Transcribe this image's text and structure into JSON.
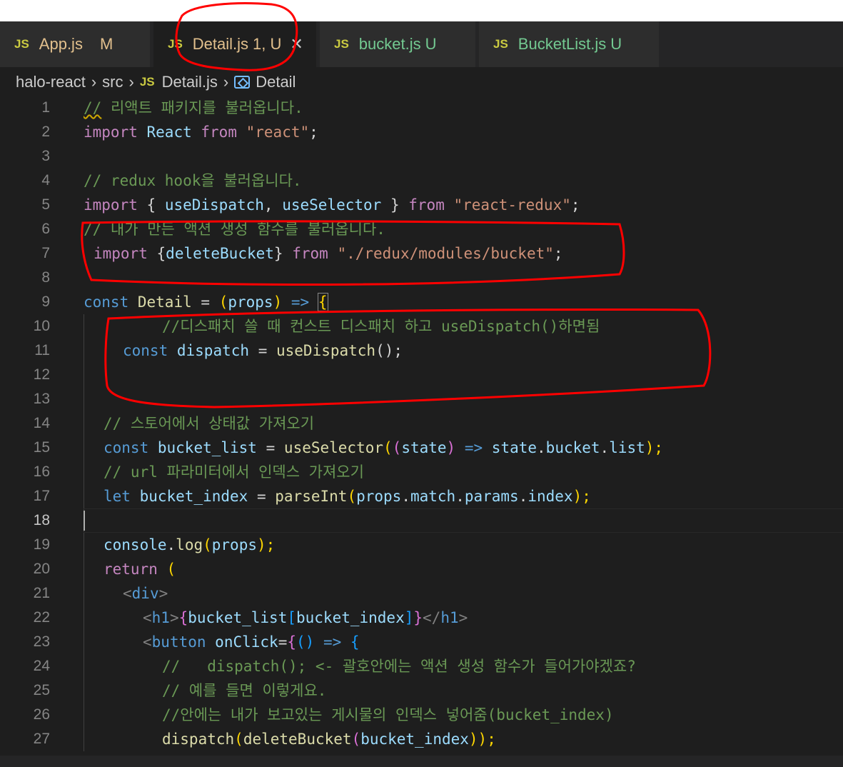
{
  "tabs": [
    {
      "badge": "JS",
      "name": "App.js",
      "status": "M"
    },
    {
      "badge": "JS",
      "name": "Detail.js",
      "status": "1, U",
      "close": "✕"
    },
    {
      "badge": "JS",
      "name": "bucket.js",
      "status": "U"
    },
    {
      "badge": "JS",
      "name": "BucketList.js",
      "status": "U"
    }
  ],
  "breadcrumb": {
    "folder": "halo-react",
    "sep": "›",
    "src": "src",
    "js_badge": "JS",
    "file": "Detail.js",
    "symbol": "Detail"
  },
  "editor": {
    "current_line": 18,
    "line_numbers": [
      "1",
      "2",
      "3",
      "4",
      "5",
      "6",
      "7",
      "8",
      "9",
      "10",
      "11",
      "12",
      "13",
      "14",
      "15",
      "16",
      "17",
      "18",
      "19",
      "20",
      "21",
      "22",
      "23",
      "24",
      "25",
      "26",
      "27"
    ],
    "line1": {
      "a": "//",
      "b": " 리액트 패키지를 불러옵니다."
    },
    "line2": {
      "a": "import",
      "b": "React",
      "c": "from",
      "d": "\"react\"",
      "e": ";"
    },
    "line4": {
      "a": "// redux hook을 불러옵니다."
    },
    "line5": {
      "a": "import",
      "b": "{",
      "c": "useDispatch",
      "d": ",",
      "e": "useSelector",
      "f": "}",
      "g": "from",
      "h": "\"react-redux\"",
      "i": ";"
    },
    "line6": {
      "a": "// 내가 만든 액션 생성 함수를 불러옵니다."
    },
    "line7": {
      "a": "import",
      "b": "{",
      "c": "deleteBucket",
      "d": "}",
      "e": "from",
      "f": "\"./redux/modules/bucket\"",
      "g": ";"
    },
    "line9": {
      "a": "const",
      "b": "Detail",
      "c": "=",
      "d": "(",
      "e": "props",
      "f": ")",
      "g": "=>",
      "h": "{"
    },
    "line10": {
      "a": "//디스패치 쓸 때 컨스트 디스패치 하고 useDispatch()하면됨"
    },
    "line11": {
      "a": "const",
      "b": "dispatch",
      "c": "=",
      "d": "useDispatch",
      "e": "();"
    },
    "line14": {
      "a": "// 스토어에서 상태값 가져오기"
    },
    "line15": {
      "a": "const",
      "b": "bucket_list",
      "c": "=",
      "d": "useSelector",
      "e": "(",
      "f": "(",
      "g": "state",
      "h": ")",
      "i": "=>",
      "j": "state",
      "k": ".",
      "l": "bucket",
      "m": ".",
      "n": "list",
      "o": ");"
    },
    "line16": {
      "a": "// url 파라미터에서 인덱스 가져오기"
    },
    "line17": {
      "a": "let",
      "b": "bucket_index",
      "c": "=",
      "d": "parseInt",
      "e": "(",
      "f": "props",
      "g": ".",
      "h": "match",
      "i": ".",
      "j": "params",
      "k": ".",
      "l": "index",
      "m": ");"
    },
    "line19": {
      "a": "console",
      "b": ".",
      "c": "log",
      "d": "(",
      "e": "props",
      "f": ");"
    },
    "line20": {
      "a": "return",
      "b": "("
    },
    "line21": {
      "a": "<",
      "b": "div",
      "c": ">"
    },
    "line22": {
      "a": "<",
      "b": "h1",
      "c": ">",
      "d": "{",
      "e": "bucket_list",
      "f": "[",
      "g": "bucket_index",
      "h": "]",
      "i": "}",
      "j": "</",
      "k": "h1",
      "l": ">"
    },
    "line23": {
      "a": "<",
      "b": "button",
      "c": "onClick",
      "d": "=",
      "e": "{",
      "f": "()",
      "g": "=>",
      "h": "{"
    },
    "line24": {
      "a": "//   dispatch(); <- 괄호안에는 액션 생성 함수가 들어가야겠죠?"
    },
    "line25": {
      "a": "// 예를 들면 이렇게요."
    },
    "line26": {
      "a": "//안에는 내가 보고있는 게시물의 인덱스 넣어줌(bucket_index)"
    },
    "line27": {
      "a": "dispatch",
      "b": "(",
      "c": "deleteBucket",
      "d": "(",
      "e": "bucket_index",
      "f": "));"
    }
  },
  "annotation_color": "#ff0000"
}
